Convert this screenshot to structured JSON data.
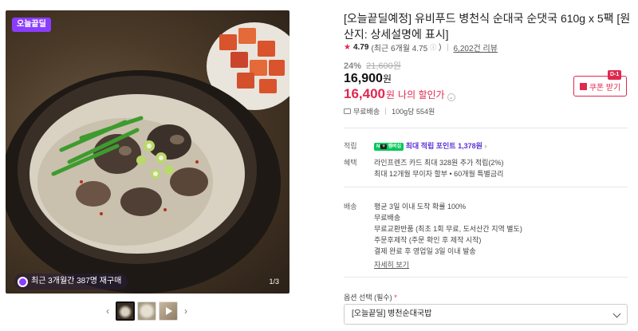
{
  "gallery": {
    "promo_tag": "오늘끝딜",
    "bought_text": "최근 3개월간 387명 재구매",
    "page_indicator": "1/3",
    "prev_arrow": "‹",
    "next_arrow": "›"
  },
  "product": {
    "title": "[오늘끝딜예정] 유비푸드 병천식 순대국 순댓국 610g x 5팩 [원산지: 상세설명에 표시]",
    "rating": "4.79",
    "rating_recent": "(최근 6개월 4.75",
    "rating_recent_close": ")",
    "review_count": "6,202건 리뷰",
    "discount_rate": "24%",
    "original_price": "21,600원",
    "price": "16,900",
    "price_unit": "원",
    "coupon_price": "16,400",
    "coupon_unit": "원",
    "coupon_text": "나의 할인가",
    "coupon_button": "쿠폰 받기",
    "dday_badge": "D-1",
    "shipping": "무료배송",
    "unit_price": "100g당 554원"
  },
  "benefits": {
    "points_label": "적립",
    "np_badge": "N",
    "np_badge_plus": "+",
    "np_badge_text": "멤버십",
    "points_value": "최대 적립 포인트 1,378원",
    "perks_label": "혜택",
    "perks_line1": "라인프렌즈 카드 최대 328원 추가 적립(2%)",
    "perks_line2": "최대 12개월 무이자 할부 • 60개월 특별금리"
  },
  "delivery": {
    "label": "배송",
    "line1": "평균 3일 이내 도착 확률 100%",
    "line2": "무료배송",
    "line3": "무료교환반품 (최초 1회 무료, 도서산간 지역 별도)",
    "line4": "주문후제작 (주문 확인 후 제작 시작)",
    "line5": "결제 완료 후 영업일 3일 이내 발송",
    "detail_link": "자세히 보기"
  },
  "options": {
    "label": "옵션 선택 (필수)",
    "required_mark": "*",
    "selected": "[오늘끝딜] 병천순대국밥"
  },
  "colors": {
    "accent": "#e0284f",
    "promo": "#8b3dff",
    "naver_green": "#03c75a"
  }
}
